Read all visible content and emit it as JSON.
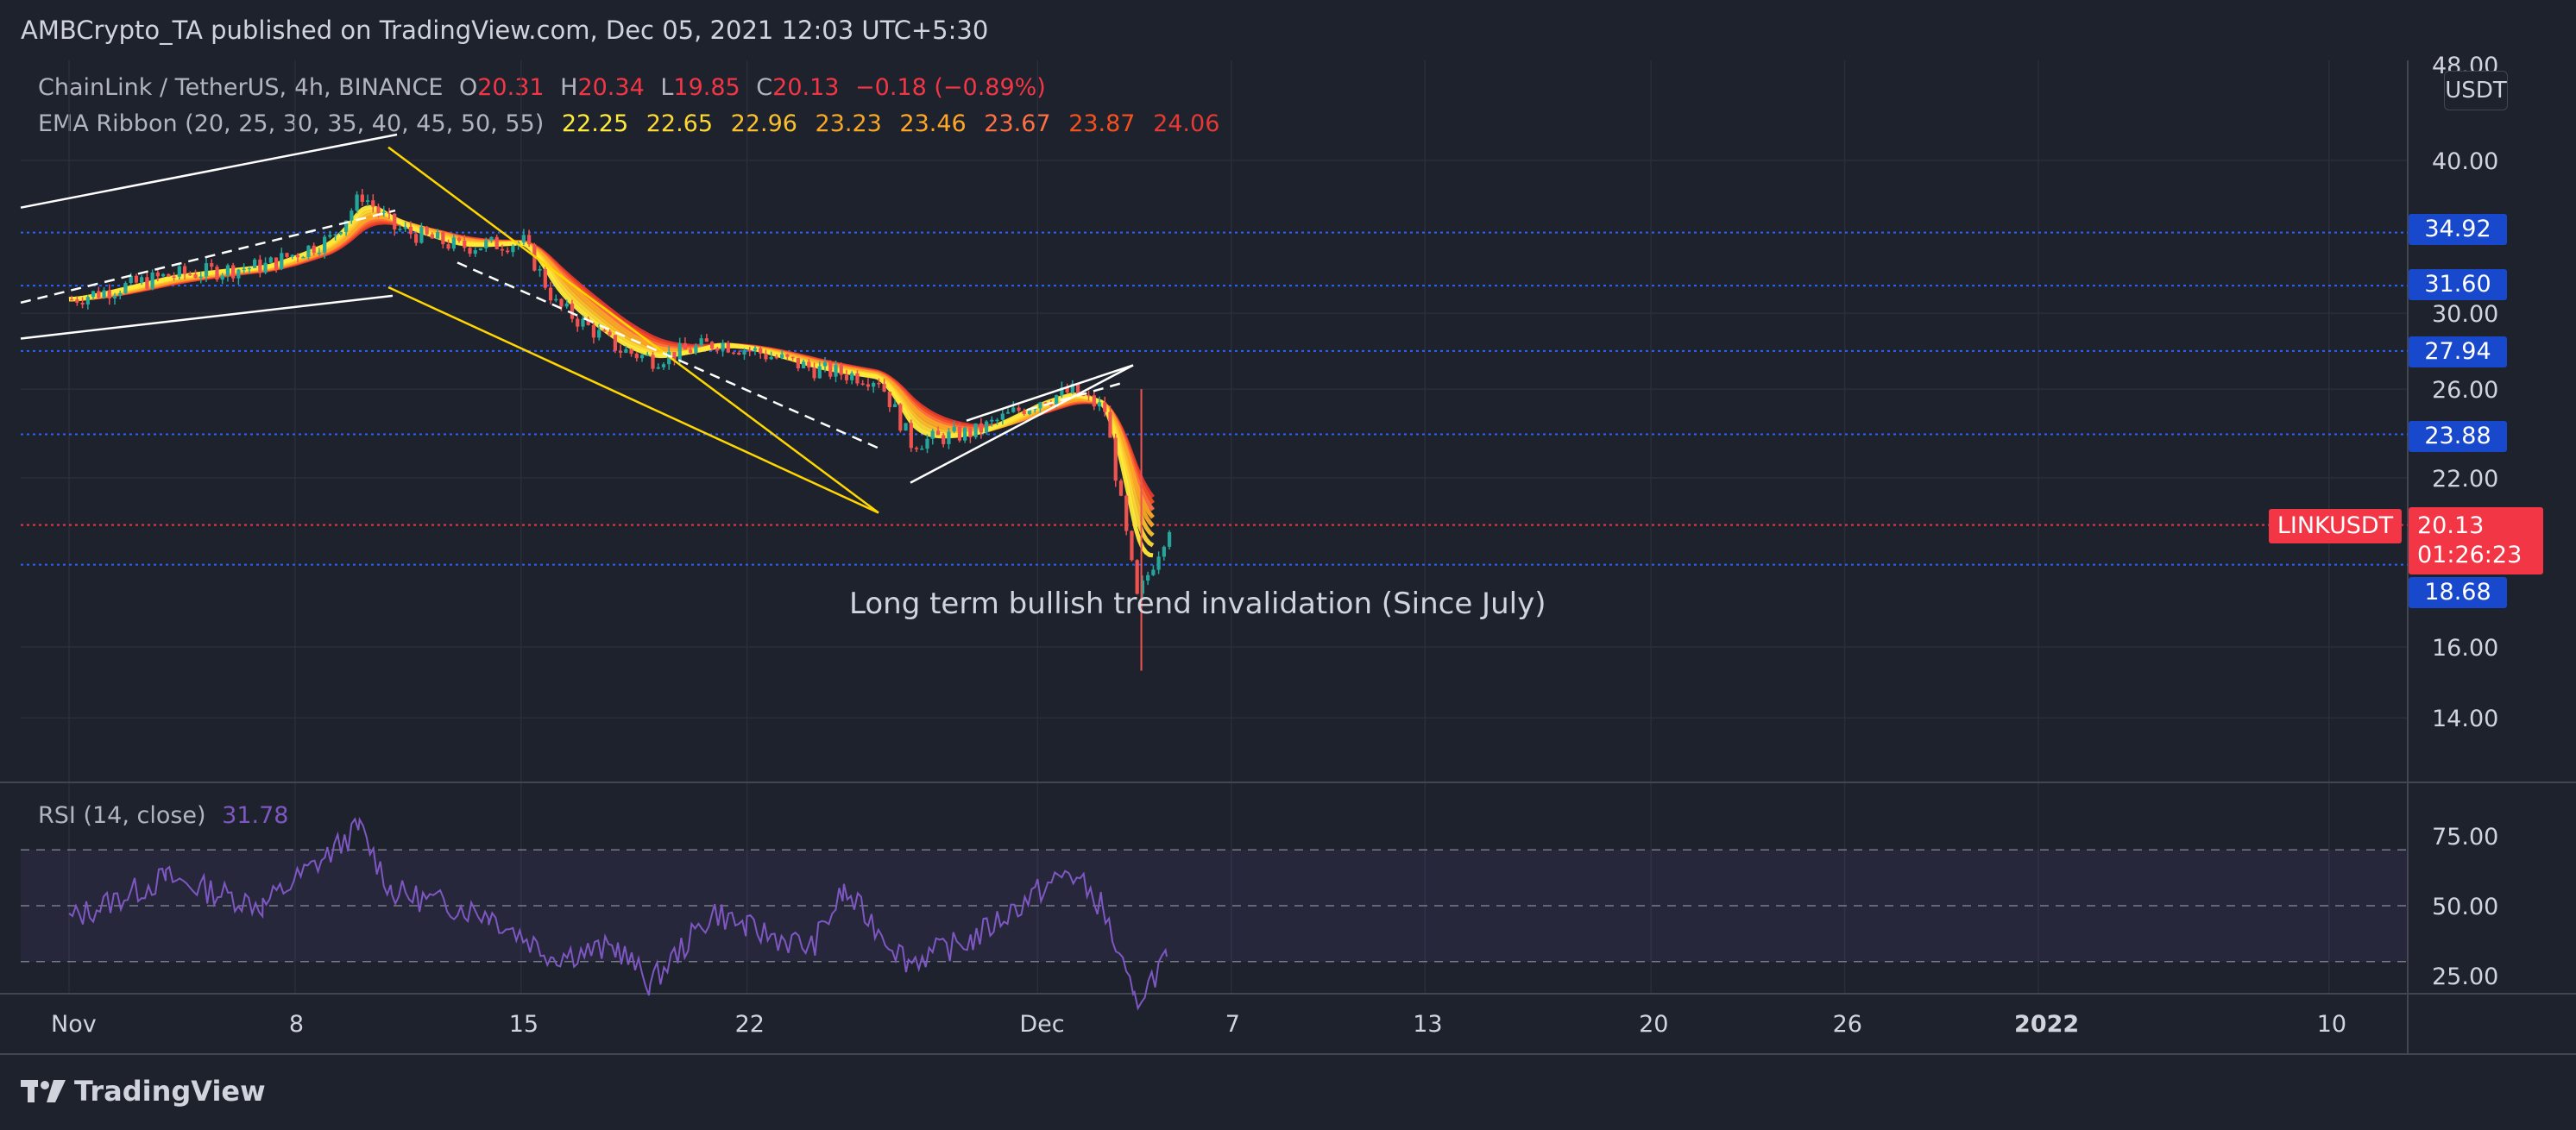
{
  "publisher": "AMBCrypto_TA published on TradingView.com, Dec 05, 2021 12:03 UTC+5:30",
  "header": {
    "symbol": "ChainLink / TetherUS, 4h, BINANCE",
    "o_label": "O",
    "o": "20.31",
    "h_label": "H",
    "h": "20.34",
    "l_label": "L",
    "l": "19.85",
    "c_label": "C",
    "c": "20.13",
    "change": "−0.18 (−0.89%)",
    "ema_label": "EMA Ribbon (20, 25, 30, 35, 40, 45, 50, 55)",
    "ema_values": [
      "22.25",
      "22.65",
      "22.96",
      "23.23",
      "23.46",
      "23.67",
      "23.87",
      "24.06"
    ],
    "ema_colors": [
      "#ffeb3b",
      "#fdd835",
      "#fbc02d",
      "#f9a825",
      "#ffa726",
      "#ff7043",
      "#f4511e",
      "#e53935"
    ]
  },
  "unit": "USDT",
  "symbol_tag": "LINKUSDT",
  "last_price": "20.13",
  "countdown": "01:26:23",
  "annotation": "Long term bullish trend invalidation (Since July)",
  "rsi_label": "RSI (14, close)",
  "rsi_value": "31.78",
  "brand": "TradingView",
  "colors": {
    "bg": "#1e222d",
    "up": "#26a69a",
    "down": "#ef5350",
    "blue": "#1848cc",
    "rsi": "#7e57c2",
    "red_badge": "#f23645"
  },
  "price_ticks": [
    "48.00",
    "40.00",
    "30.00",
    "26.00",
    "22.00",
    "16.00",
    "14.00"
  ],
  "levels": [
    "34.92",
    "31.60",
    "27.94",
    "23.88",
    "18.68"
  ],
  "rsi_ticks": [
    "75.00",
    "50.00",
    "25.00"
  ],
  "time_ticks": [
    "Nov",
    "8",
    "15",
    "22",
    "Dec",
    "7",
    "13",
    "20",
    "26",
    "2022",
    "10"
  ],
  "chart_data": [
    {
      "type": "candlestick",
      "title": "ChainLink / TetherUS, 4h, BINANCE",
      "ylabel": "USDT",
      "y_scale": "log",
      "ylim": [
        12.5,
        48
      ],
      "x_ticks": [
        "Nov",
        "8",
        "15",
        "22",
        "Dec",
        "7",
        "13",
        "20",
        "26",
        "2022",
        "10"
      ],
      "x_range": [
        "2021-11-01",
        "2022-01-13"
      ],
      "close_path": [
        {
          "date": "2021-11-01",
          "price": 30.8
        },
        {
          "date": "2021-11-04",
          "price": 32.2
        },
        {
          "date": "2021-11-07",
          "price": 32.8
        },
        {
          "date": "2021-11-09",
          "price": 34.5
        },
        {
          "date": "2021-11-10",
          "price": 37.5
        },
        {
          "date": "2021-11-11",
          "price": 35.2
        },
        {
          "date": "2021-11-13",
          "price": 34.0
        },
        {
          "date": "2021-11-15",
          "price": 34.3
        },
        {
          "date": "2021-11-16",
          "price": 30.5
        },
        {
          "date": "2021-11-18",
          "price": 28.0
        },
        {
          "date": "2021-11-19",
          "price": 27.5
        },
        {
          "date": "2021-11-21",
          "price": 28.4
        },
        {
          "date": "2021-11-22",
          "price": 28.0
        },
        {
          "date": "2021-11-24",
          "price": 27.0
        },
        {
          "date": "2021-11-26",
          "price": 26.5
        },
        {
          "date": "2021-11-27",
          "price": 23.5
        },
        {
          "date": "2021-11-29",
          "price": 24.0
        },
        {
          "date": "2021-12-01",
          "price": 25.5
        },
        {
          "date": "2021-12-02",
          "price": 25.9
        },
        {
          "date": "2021-12-03",
          "price": 25.0
        },
        {
          "date": "2021-12-04",
          "price": 17.5
        },
        {
          "date": "2021-12-05",
          "price": 20.13
        }
      ],
      "last_close": 20.13,
      "ema_ribbon_last": [
        22.25,
        22.65,
        22.96,
        23.23,
        23.46,
        23.67,
        23.87,
        24.06
      ],
      "horizontal_levels": [
        34.92,
        31.6,
        27.94,
        23.88,
        18.68
      ],
      "annotations": [
        "Long term bullish trend invalidation (Since July)"
      ]
    },
    {
      "type": "line",
      "title": "RSI (14, close)",
      "ylim": [
        10,
        90
      ],
      "bands": [
        30,
        50,
        70
      ],
      "last_value": 31.78,
      "x": [
        "2021-11-01",
        "2021-11-04",
        "2021-11-07",
        "2021-11-09",
        "2021-11-10",
        "2021-11-11",
        "2021-11-14",
        "2021-11-16",
        "2021-11-18",
        "2021-11-19",
        "2021-11-21",
        "2021-11-22",
        "2021-11-24",
        "2021-11-25",
        "2021-11-27",
        "2021-11-29",
        "2021-12-01",
        "2021-12-02",
        "2021-12-03",
        "2021-12-04",
        "2021-12-05"
      ],
      "values": [
        45,
        60,
        50,
        68,
        78,
        55,
        47,
        32,
        35,
        22,
        48,
        42,
        35,
        55,
        30,
        38,
        55,
        62,
        50,
        15,
        31.78
      ]
    }
  ]
}
